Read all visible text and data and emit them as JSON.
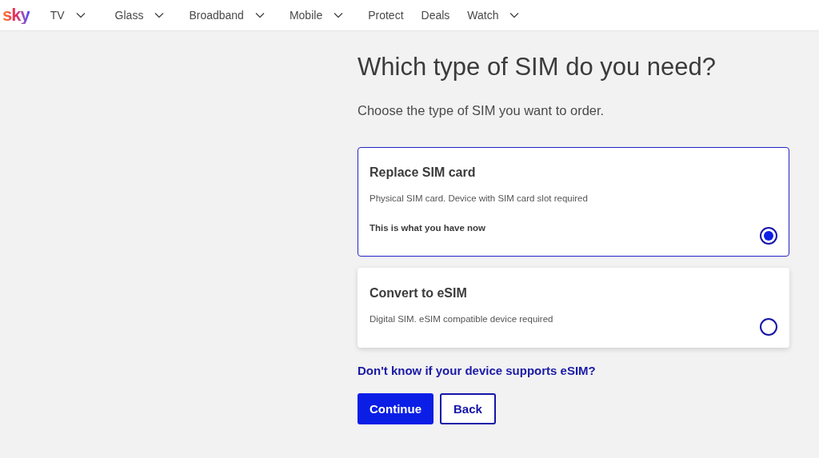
{
  "logo": "sky",
  "nav": [
    {
      "label": "TV",
      "dropdown": true
    },
    {
      "label": "Glass",
      "dropdown": true
    },
    {
      "label": "Broadband",
      "dropdown": true
    },
    {
      "label": "Mobile",
      "dropdown": true
    },
    {
      "label": "Protect",
      "dropdown": false
    },
    {
      "label": "Deals",
      "dropdown": false
    },
    {
      "label": "Watch",
      "dropdown": true
    }
  ],
  "title": "Which type of SIM do you need?",
  "subtitle": "Choose the type of SIM you want to order.",
  "options": [
    {
      "title": "Replace SIM card",
      "description": "Physical SIM card. Device with SIM card slot required",
      "note": "This is what you have now",
      "selected": true
    },
    {
      "title": "Convert to eSIM",
      "description": "Digital SIM. eSIM compatible device required",
      "selected": false
    }
  ],
  "help_link": "Don't know if your device supports eSIM?",
  "buttons": [
    {
      "label": "Continue",
      "kind": "primary"
    },
    {
      "label": "Back",
      "kind": "secondary"
    }
  ]
}
